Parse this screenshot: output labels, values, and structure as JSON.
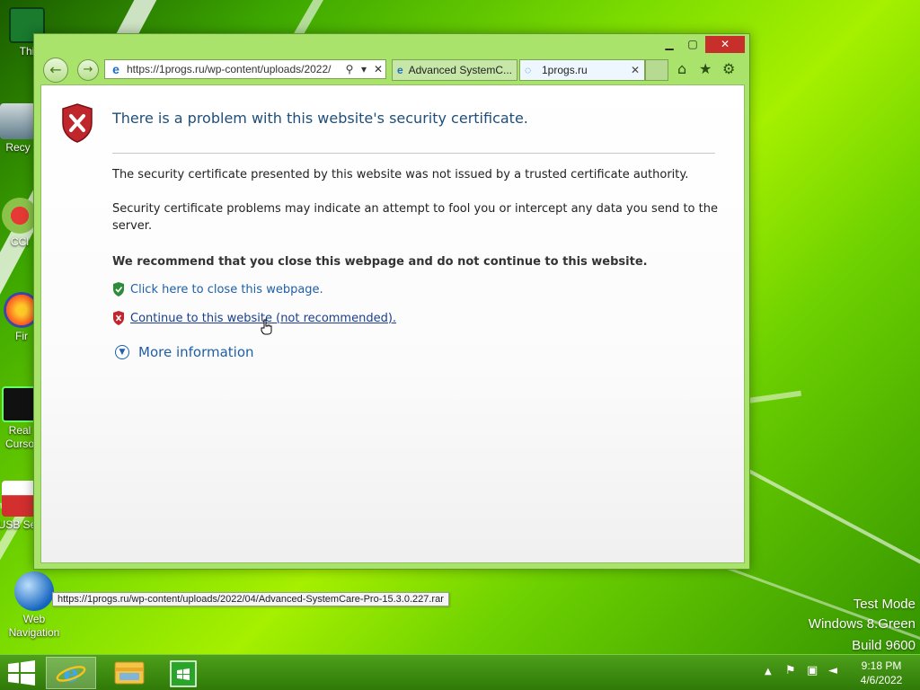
{
  "desktop": {
    "icons": [
      {
        "label": "Thi"
      },
      {
        "label": "Recy"
      },
      {
        "label": "CCl"
      },
      {
        "label": "Fir"
      },
      {
        "label": "Real Curso"
      },
      {
        "label": "USB Sec"
      },
      {
        "label": "Web Navigation"
      }
    ],
    "watermark": {
      "line1": "Test Mode",
      "line2": "Windows 8.Green",
      "line3": "Build 9600"
    }
  },
  "browser": {
    "address": {
      "url": "https://1progs.ru/wp-content/uploads/2022/"
    },
    "tabs": [
      {
        "title": "Advanced SystemC..."
      },
      {
        "title": "1progs.ru"
      }
    ],
    "window_controls": {
      "minimize": "▁",
      "maximize": "▢",
      "close": "✕"
    },
    "toolbar_icons": [
      "home-icon",
      "favorites-star-icon",
      "settings-gear-icon"
    ]
  },
  "page": {
    "title": "There is a problem with this website's security certificate.",
    "para1": "The security certificate presented by this website was not issued by a trusted certificate authority.",
    "para2": "Security certificate problems may indicate an attempt to fool you or intercept any data you send to the server.",
    "recommend": "We recommend that you close this webpage and do not continue to this website.",
    "close_link": "Click here to close this webpage.",
    "continue_link": "Continue to this website (not recommended).",
    "more_info": "More information"
  },
  "status_url": "https://1progs.ru/wp-content/uploads/2022/04/Advanced-SystemCare-Pro-15.3.0.227.rar",
  "taskbar": {
    "clock_time": "9:18 PM",
    "clock_date": "4/6/2022"
  },
  "colors": {
    "accent": "#1e5fa8",
    "error_red": "#c7302a",
    "taskbar": "#3d8c12"
  }
}
